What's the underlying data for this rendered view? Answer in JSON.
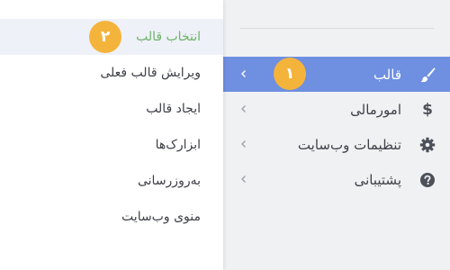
{
  "main_menu": {
    "items": [
      {
        "label": "قالب",
        "icon": "paintbrush-icon",
        "badge": "۱",
        "active": true
      },
      {
        "label": "امورمالی",
        "icon": "dollar-icon"
      },
      {
        "label": "تنظیمات وب‌سایت",
        "icon": "gear-icon"
      },
      {
        "label": "پشتیبانی",
        "icon": "question-circle-icon"
      }
    ]
  },
  "submenu": {
    "items": [
      {
        "label": "انتخاب قالب",
        "badge": "۲",
        "active": true
      },
      {
        "label": "ویرایش قالب فعلی"
      },
      {
        "label": "ایجاد قالب"
      },
      {
        "label": "ابزارک‌ها"
      },
      {
        "label": "به‌روزرسانی"
      },
      {
        "label": "منوی وب‌سایت"
      }
    ]
  },
  "colors": {
    "active_bg": "#6f8fe0",
    "badge": "#f4b43c",
    "submenu_active_text": "#6fb36a"
  }
}
